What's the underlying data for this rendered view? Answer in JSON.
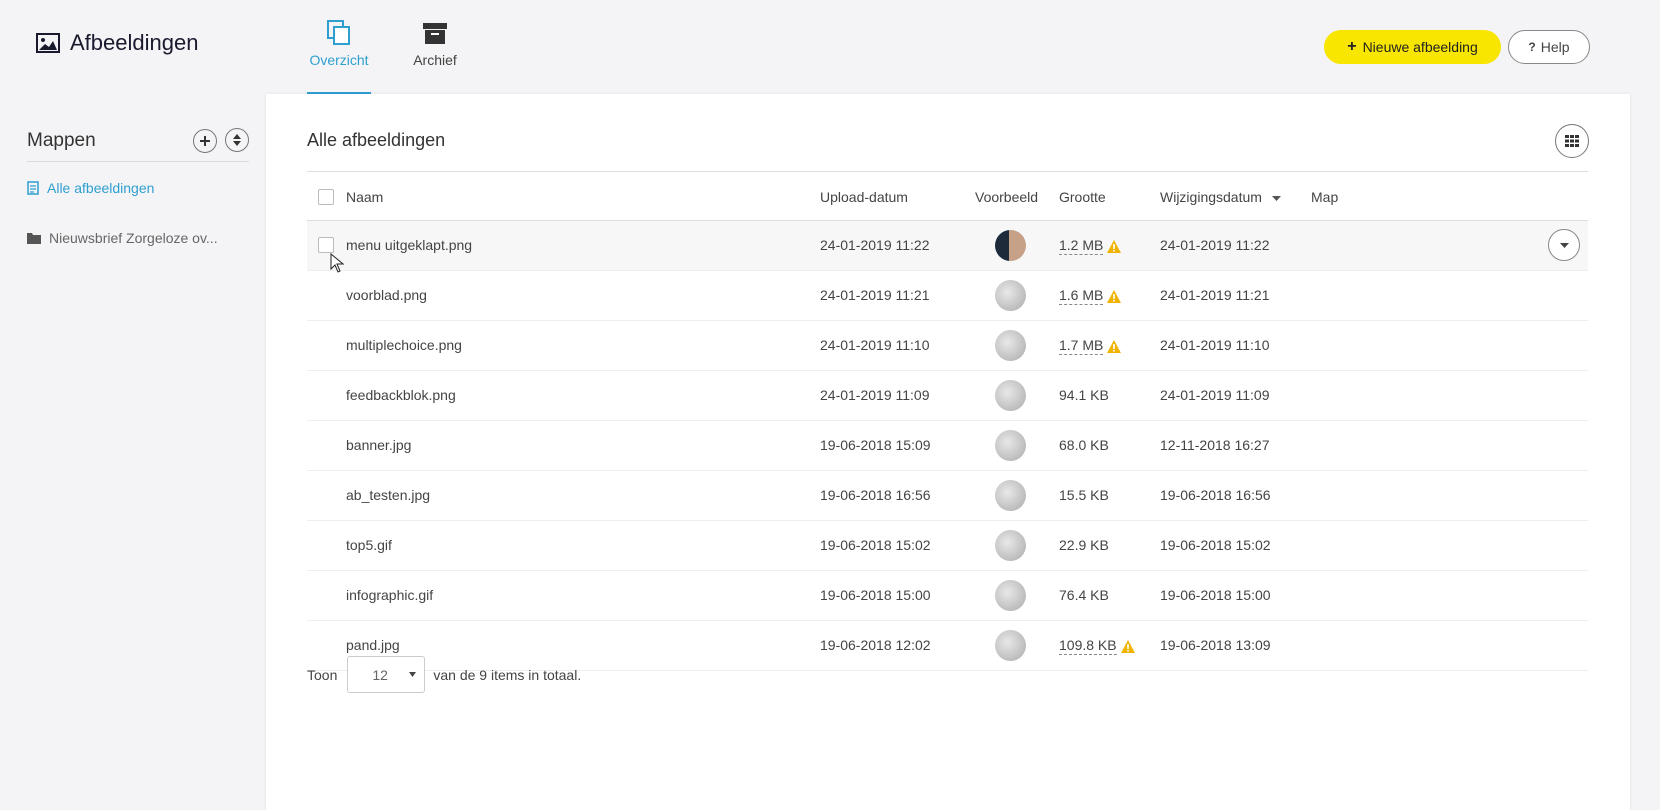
{
  "header": {
    "app_title": "Afbeeldingen",
    "tabs": [
      {
        "label": "Overzicht",
        "active": true
      },
      {
        "label": "Archief",
        "active": false
      }
    ],
    "new_button": "Nieuwe afbeelding",
    "help_button": "Help"
  },
  "sidebar": {
    "title": "Mappen",
    "items": [
      {
        "label": "Alle afbeeldingen",
        "active": true
      },
      {
        "label": "Nieuwsbrief Zorgeloze ov...",
        "active": false
      }
    ]
  },
  "main": {
    "title": "Alle afbeeldingen",
    "columns": {
      "name": "Naam",
      "upload_date": "Upload-datum",
      "preview": "Voorbeeld",
      "size": "Grootte",
      "modified": "Wijzigingsdatum",
      "folder": "Map"
    },
    "rows": [
      {
        "name": "menu uitgeklapt.png",
        "upload": "24-01-2019 11:22",
        "size": "1.2 MB",
        "warn": true,
        "modified": "24-01-2019 11:22"
      },
      {
        "name": "voorblad.png",
        "upload": "24-01-2019 11:21",
        "size": "1.6 MB",
        "warn": true,
        "modified": "24-01-2019 11:21"
      },
      {
        "name": "multiplechoice.png",
        "upload": "24-01-2019 11:10",
        "size": "1.7 MB",
        "warn": true,
        "modified": "24-01-2019 11:10"
      },
      {
        "name": "feedbackblok.png",
        "upload": "24-01-2019 11:09",
        "size": "94.1 KB",
        "warn": false,
        "modified": "24-01-2019 11:09"
      },
      {
        "name": "banner.jpg",
        "upload": "19-06-2018 15:09",
        "size": "68.0 KB",
        "warn": false,
        "modified": "12-11-2018 16:27"
      },
      {
        "name": "ab_testen.jpg",
        "upload": "19-06-2018 16:56",
        "size": "15.5 KB",
        "warn": false,
        "modified": "19-06-2018 16:56"
      },
      {
        "name": "top5.gif",
        "upload": "19-06-2018 15:02",
        "size": "22.9 KB",
        "warn": false,
        "modified": "19-06-2018 15:02"
      },
      {
        "name": "infographic.gif",
        "upload": "19-06-2018 15:00",
        "size": "76.4 KB",
        "warn": false,
        "modified": "19-06-2018 15:00"
      },
      {
        "name": "pand.jpg",
        "upload": "19-06-2018 12:02",
        "size": "109.8 KB",
        "warn": true,
        "modified": "19-06-2018 13:09"
      }
    ]
  },
  "footer": {
    "show_label": "Toon",
    "page_size": "12",
    "total_text": "van de 9 items in totaal."
  },
  "colors": {
    "accent": "#2f9fd0",
    "primary_button": "#f8e600",
    "warning": "#f0b400"
  }
}
